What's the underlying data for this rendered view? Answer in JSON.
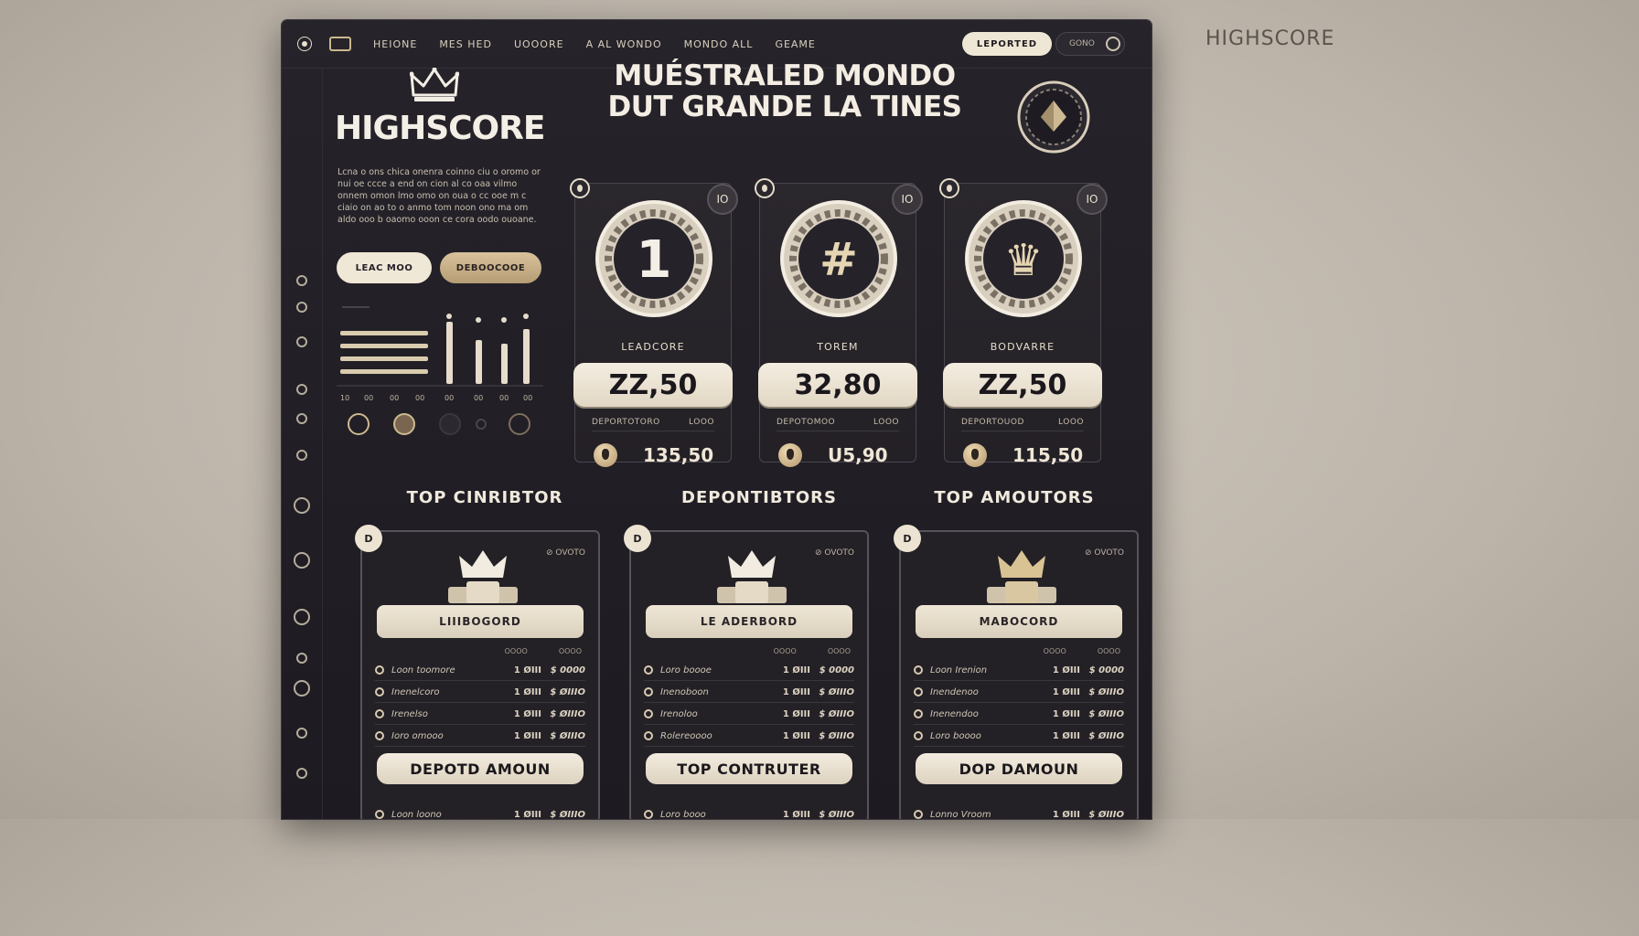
{
  "corner_brand": "HIGHSCORE",
  "topbar": {
    "nav": [
      "HEIONE",
      "MES HED",
      "UOOORE",
      "A AL WONDO",
      "MONDO ALL",
      "GEAME"
    ],
    "primary_pill": "LEPORTED",
    "secondary_pill": "GONO"
  },
  "brand": {
    "title": "HIGHSCORE",
    "description": "Lcna o ons chica onenra coinno ciu o oromo or nui oe ccce a end on cion al co oaa vilmo onnem omon lmo omo on oua o cc ooe m c ciaio on ao to o anmo tom noon ono ma om aldo ooo b oaomo ooon ce cora oodo ouoane.",
    "buttons": [
      "LEAC MOO",
      "DEBOOCOOE"
    ]
  },
  "hero": {
    "line1": "MUÉSTRALED MONDO",
    "line2": "DUT GRANDE LA TINES"
  },
  "mini_chart": {
    "tick_labels": [
      "10",
      "00",
      "00",
      "00",
      "00",
      "00",
      "00",
      "00"
    ]
  },
  "rank_cards": [
    {
      "medal_text": "1",
      "tag": "IO",
      "label": "LEADCORE",
      "score": "ZZ,50",
      "sub_left": "DEPORTOTORO",
      "sub_right": "LOOO",
      "amount": "135,50"
    },
    {
      "medal_text": "#",
      "tag": "IO",
      "label": "TOREM",
      "score": "32,80",
      "sub_left": "DEPOTOMOO",
      "sub_right": "LOOO",
      "amount": "U5,90"
    },
    {
      "medal_text": "♛",
      "tag": "IO",
      "label": "BODVARRE",
      "score": "ZZ,50",
      "sub_left": "DEPORTOUOD",
      "sub_right": "LOOO",
      "amount": "115,50"
    }
  ],
  "columns": [
    {
      "title": "TOP CINRIBTOR",
      "badge": "D",
      "meta": "⊘ OVOTO",
      "bar_label": "LIIIBOGORD",
      "col_headers": [
        "OOOO",
        "OOOO"
      ],
      "rows": [
        {
          "name": "Loon toomore",
          "v1": "1 ØIII",
          "v2": "$ 0000"
        },
        {
          "name": "Inenelcoro",
          "v1": "1 ØIII",
          "v2": "$ ØIIIO"
        },
        {
          "name": "Irenelso",
          "v1": "1 ØIII",
          "v2": "$ ØIIIO"
        },
        {
          "name": "Ioro omooo",
          "v1": "1 ØIII",
          "v2": "$ ØIIIO"
        }
      ],
      "cta": "DEPOTD AMOUN",
      "last_row": {
        "name": "Loon loono",
        "v1": "1 ØIII",
        "v2": "$ ØIIIO"
      }
    },
    {
      "title": "DEPONTIBTORS",
      "badge": "D",
      "meta": "⊘ OVOTO",
      "bar_label": "LE ADERBORD",
      "col_headers": [
        "OOOO",
        "OOOO"
      ],
      "rows": [
        {
          "name": "Loro boooe",
          "v1": "1 ØIII",
          "v2": "$ 0000"
        },
        {
          "name": "Inenoboon",
          "v1": "1 ØIII",
          "v2": "$ ØIIIO"
        },
        {
          "name": "Irenoloo",
          "v1": "1 ØIII",
          "v2": "$ ØIIIO"
        },
        {
          "name": "Rolereoooo",
          "v1": "1 ØIII",
          "v2": "$ ØIIIO"
        }
      ],
      "cta": "TOP CONTRUTER",
      "last_row": {
        "name": "Loro booo",
        "v1": "1 ØIII",
        "v2": "$ ØIIIO"
      }
    },
    {
      "title": "TOP AMOUTORS",
      "badge": "D",
      "meta": "⊘ OVOTO",
      "bar_label": "MABOCORD",
      "col_headers": [
        "OOOO",
        "OOOO"
      ],
      "rows": [
        {
          "name": "Loon Irenion",
          "v1": "1 ØIII",
          "v2": "$ 0000"
        },
        {
          "name": "Inendenoo",
          "v1": "1 ØIII",
          "v2": "$ ØIIIO"
        },
        {
          "name": "Inenendoo",
          "v1": "1 ØIII",
          "v2": "$ ØIIIO"
        },
        {
          "name": "Loro boooo",
          "v1": "1 ØIII",
          "v2": "$ ØIIIO"
        }
      ],
      "cta": "DOP DAMOUN",
      "last_row": {
        "name": "Lonno Vroom",
        "v1": "1 ØIII",
        "v2": "$ ØIIIO"
      }
    }
  ],
  "colors": {
    "background": "#bdb5aa",
    "panel": "#1d1b21",
    "cream": "#efe7d6",
    "gold": "#cdb992"
  }
}
